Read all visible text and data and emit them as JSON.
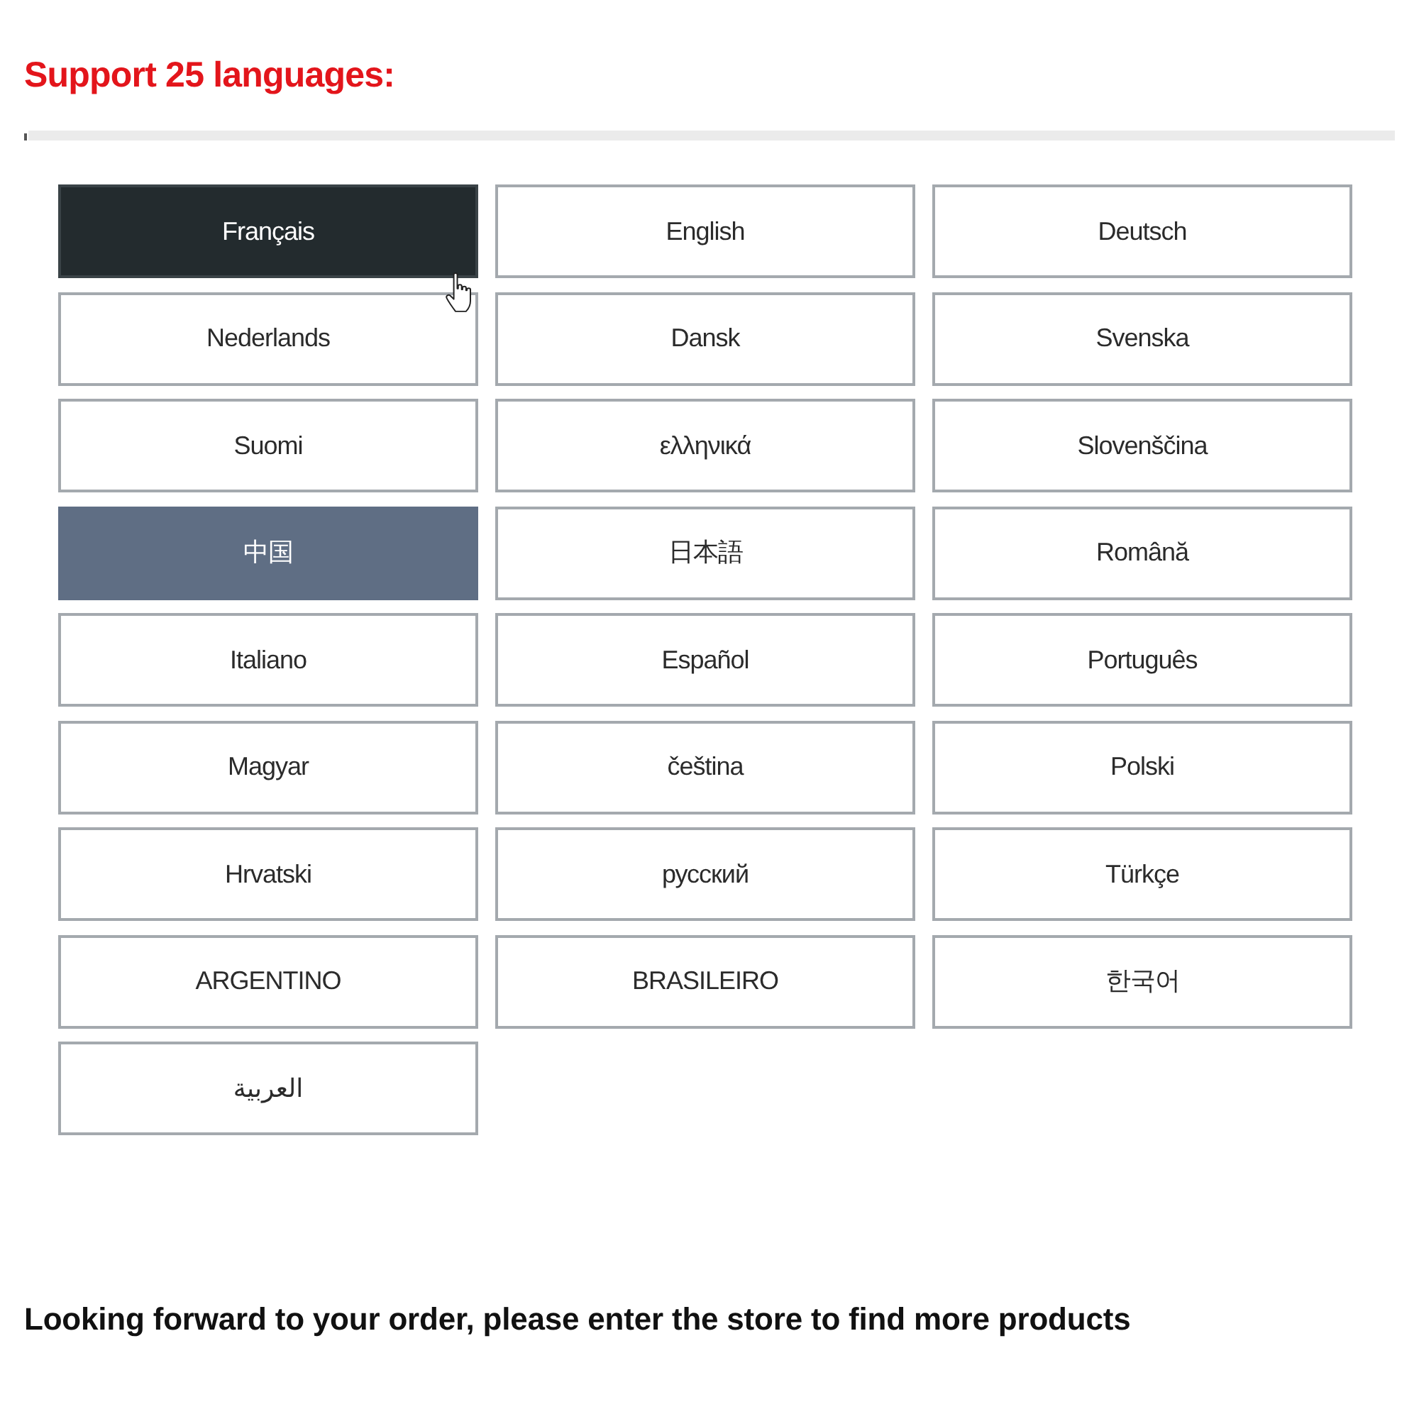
{
  "heading": "Support 25 languages:",
  "languages": [
    {
      "label": "Français",
      "selected": false,
      "hovered": true
    },
    {
      "label": "English",
      "selected": false,
      "hovered": false
    },
    {
      "label": "Deutsch",
      "selected": false,
      "hovered": false
    },
    {
      "label": "Nederlands",
      "selected": false,
      "hovered": false
    },
    {
      "label": "Dansk",
      "selected": false,
      "hovered": false
    },
    {
      "label": "Svenska",
      "selected": false,
      "hovered": false
    },
    {
      "label": "Suomi",
      "selected": false,
      "hovered": false
    },
    {
      "label": "ελληνικά",
      "selected": false,
      "hovered": false
    },
    {
      "label": "Slovenščina",
      "selected": false,
      "hovered": false
    },
    {
      "label": "中国",
      "selected": true,
      "hovered": false
    },
    {
      "label": "日本語",
      "selected": false,
      "hovered": false
    },
    {
      "label": "Română",
      "selected": false,
      "hovered": false
    },
    {
      "label": "Italiano",
      "selected": false,
      "hovered": false
    },
    {
      "label": "Español",
      "selected": false,
      "hovered": false
    },
    {
      "label": "Português",
      "selected": false,
      "hovered": false
    },
    {
      "label": "Magyar",
      "selected": false,
      "hovered": false
    },
    {
      "label": "čeština",
      "selected": false,
      "hovered": false
    },
    {
      "label": "Polski",
      "selected": false,
      "hovered": false
    },
    {
      "label": "Hrvatski",
      "selected": false,
      "hovered": false
    },
    {
      "label": "русский",
      "selected": false,
      "hovered": false
    },
    {
      "label": "Türkçe",
      "selected": false,
      "hovered": false
    },
    {
      "label": "ARGENTINO",
      "selected": false,
      "hovered": false
    },
    {
      "label": "BRASILEIRO",
      "selected": false,
      "hovered": false
    },
    {
      "label": "한국어",
      "selected": false,
      "hovered": false
    },
    {
      "label": "العربية",
      "selected": false,
      "hovered": false
    }
  ],
  "footer_text": "Looking forward to your order, please enter the store to find more products"
}
